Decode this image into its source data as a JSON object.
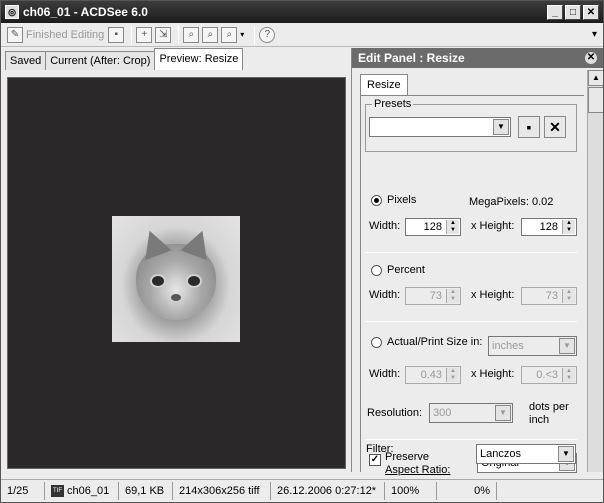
{
  "window": {
    "title": "ch06_01 - ACDSee 6.0"
  },
  "toolbar": {
    "finished_label": "Finished Editing"
  },
  "tabs": [
    {
      "label": "Saved"
    },
    {
      "label": "Current (After: Crop)"
    },
    {
      "label": "Preview: Resize"
    }
  ],
  "panel": {
    "title": "Edit Panel : Resize",
    "tab": "Resize",
    "presets_label": "Presets",
    "pixels_label": "Pixels",
    "megapixels": "MegaPixels: 0.02",
    "width_label": "Width:",
    "height_label": "x Height:",
    "px_width": "128",
    "px_height": "128",
    "percent_label": "Percent",
    "pct_width": "73",
    "pct_height": "73",
    "actual_label": "Actual/Print Size in:",
    "units": "inches",
    "act_width": "0.43",
    "act_height": "0.<3",
    "resolution_label": "Resolution:",
    "resolution": "300",
    "dots_label": "dots per inch",
    "preserve_label": "Preserve",
    "aspect_label": "Aspect Ratio:",
    "aspect_value": "Original",
    "filter_label": "Filter:",
    "filter_value": "Lanczos"
  },
  "status": {
    "index": "1/25",
    "file": "ch06_01",
    "size": "69,1 KB",
    "dims": "214x306x256 tiff",
    "date": "26.12.2006 0:27:12*",
    "zoom": "100%",
    "progress": "0%"
  }
}
